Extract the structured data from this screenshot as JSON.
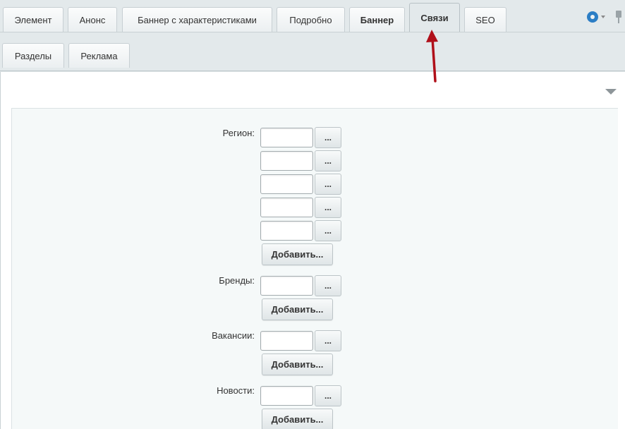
{
  "tabs": [
    {
      "label": "Элемент"
    },
    {
      "label": "Анонс"
    },
    {
      "label": "Баннер с характеристиками"
    },
    {
      "label": "Подробно"
    },
    {
      "label": "Баннер"
    },
    {
      "label": "Связи"
    },
    {
      "label": "SEO"
    }
  ],
  "active_tab": "Связи",
  "subtabs": [
    {
      "label": "Разделы"
    },
    {
      "label": "Реклама"
    }
  ],
  "form": {
    "region": {
      "label": "Регион:",
      "values": [
        "",
        "",
        "",
        "",
        ""
      ],
      "browse_label": "...",
      "add_label": "Добавить..."
    },
    "brands": {
      "label": "Бренды:",
      "values": [
        ""
      ],
      "browse_label": "...",
      "add_label": "Добавить..."
    },
    "vacancies": {
      "label": "Вакансии:",
      "values": [
        ""
      ],
      "browse_label": "...",
      "add_label": "Добавить..."
    },
    "news": {
      "label": "Новости:",
      "values": [
        ""
      ],
      "browse_label": "...",
      "add_label": "Добавить..."
    }
  },
  "icons": {
    "settings": "gear-icon",
    "pin": "pin-icon",
    "collapse": "collapse-arrow-icon"
  },
  "colors": {
    "accent": "#2c7ec5",
    "annotation_arrow": "#b0101a",
    "page_bg": "#e3e9eb",
    "panel_bg": "#f5f9f9"
  }
}
